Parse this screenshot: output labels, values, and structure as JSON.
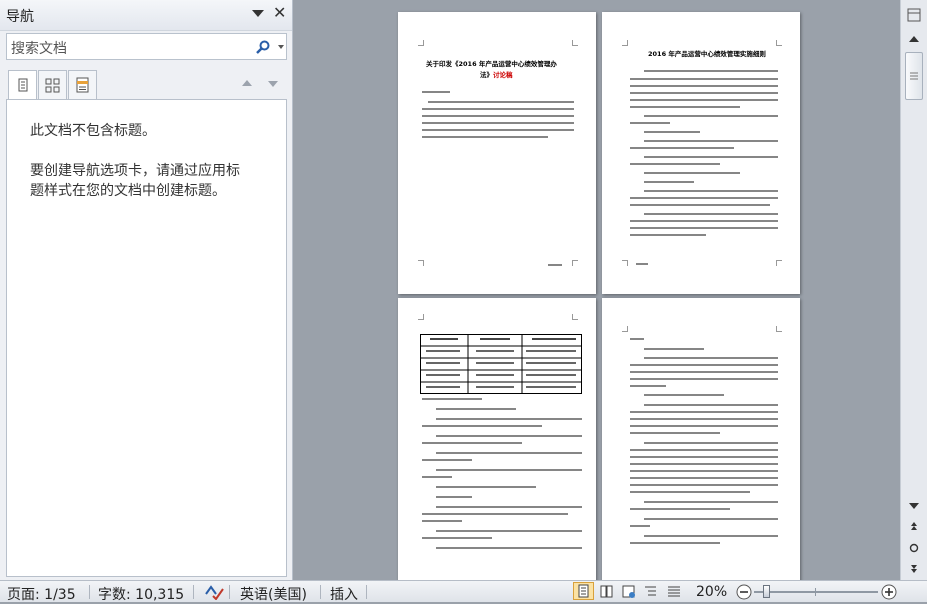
{
  "nav_pane": {
    "title": "导航",
    "search_placeholder": "搜索文档",
    "tabs": [
      "browse-headings",
      "browse-pages",
      "browse-results"
    ],
    "message_line1": "此文档不包含标题。",
    "message_line2a": "要创建导航选项卡，请通过应用标",
    "message_line2b": "题样式在您的文档中创建标题。"
  },
  "pages": {
    "p1": {
      "title_a": "关于印发《2016 年产品运营中心绩效管理办",
      "title_b": "法》",
      "title_red": "讨论稿"
    },
    "p2": {
      "title": "2016 年产品运营中心绩效管理实施细则"
    }
  },
  "status_bar": {
    "page": "页面: 1/35",
    "words": "字数: 10,315",
    "language": "英语(美国)",
    "mode": "插入",
    "zoom": "20%",
    "zoom_level": 0.2
  }
}
